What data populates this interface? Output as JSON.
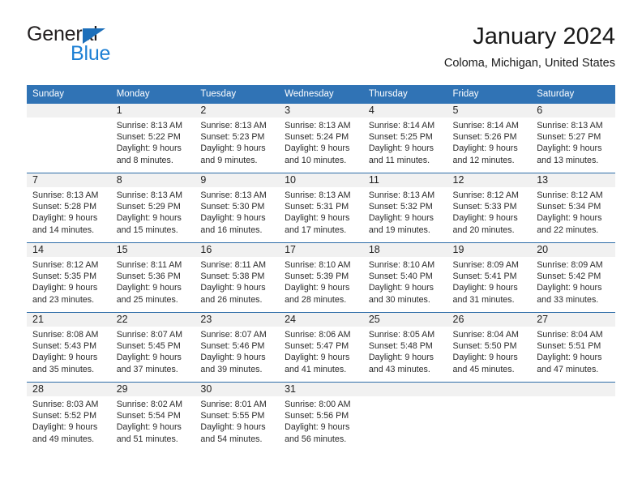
{
  "brand": {
    "name_part1": "General",
    "name_part2": "Blue",
    "triangle_color": "#1c6fba",
    "blue_color": "#1c7fd4"
  },
  "header": {
    "title": "January 2024",
    "subtitle": "Coloma, Michigan, United States"
  },
  "theme": {
    "header_blue": "#3073b5",
    "rule_blue": "#2e6da8",
    "daynum_band": "#f1f1f1"
  },
  "weekday_headers": [
    "Sunday",
    "Monday",
    "Tuesday",
    "Wednesday",
    "Thursday",
    "Friday",
    "Saturday"
  ],
  "weeks": [
    [
      {
        "day": "",
        "lines": []
      },
      {
        "day": "1",
        "lines": [
          "Sunrise: 8:13 AM",
          "Sunset: 5:22 PM",
          "Daylight: 9 hours",
          "and 8 minutes."
        ]
      },
      {
        "day": "2",
        "lines": [
          "Sunrise: 8:13 AM",
          "Sunset: 5:23 PM",
          "Daylight: 9 hours",
          "and 9 minutes."
        ]
      },
      {
        "day": "3",
        "lines": [
          "Sunrise: 8:13 AM",
          "Sunset: 5:24 PM",
          "Daylight: 9 hours",
          "and 10 minutes."
        ]
      },
      {
        "day": "4",
        "lines": [
          "Sunrise: 8:14 AM",
          "Sunset: 5:25 PM",
          "Daylight: 9 hours",
          "and 11 minutes."
        ]
      },
      {
        "day": "5",
        "lines": [
          "Sunrise: 8:14 AM",
          "Sunset: 5:26 PM",
          "Daylight: 9 hours",
          "and 12 minutes."
        ]
      },
      {
        "day": "6",
        "lines": [
          "Sunrise: 8:13 AM",
          "Sunset: 5:27 PM",
          "Daylight: 9 hours",
          "and 13 minutes."
        ]
      }
    ],
    [
      {
        "day": "7",
        "lines": [
          "Sunrise: 8:13 AM",
          "Sunset: 5:28 PM",
          "Daylight: 9 hours",
          "and 14 minutes."
        ]
      },
      {
        "day": "8",
        "lines": [
          "Sunrise: 8:13 AM",
          "Sunset: 5:29 PM",
          "Daylight: 9 hours",
          "and 15 minutes."
        ]
      },
      {
        "day": "9",
        "lines": [
          "Sunrise: 8:13 AM",
          "Sunset: 5:30 PM",
          "Daylight: 9 hours",
          "and 16 minutes."
        ]
      },
      {
        "day": "10",
        "lines": [
          "Sunrise: 8:13 AM",
          "Sunset: 5:31 PM",
          "Daylight: 9 hours",
          "and 17 minutes."
        ]
      },
      {
        "day": "11",
        "lines": [
          "Sunrise: 8:13 AM",
          "Sunset: 5:32 PM",
          "Daylight: 9 hours",
          "and 19 minutes."
        ]
      },
      {
        "day": "12",
        "lines": [
          "Sunrise: 8:12 AM",
          "Sunset: 5:33 PM",
          "Daylight: 9 hours",
          "and 20 minutes."
        ]
      },
      {
        "day": "13",
        "lines": [
          "Sunrise: 8:12 AM",
          "Sunset: 5:34 PM",
          "Daylight: 9 hours",
          "and 22 minutes."
        ]
      }
    ],
    [
      {
        "day": "14",
        "lines": [
          "Sunrise: 8:12 AM",
          "Sunset: 5:35 PM",
          "Daylight: 9 hours",
          "and 23 minutes."
        ]
      },
      {
        "day": "15",
        "lines": [
          "Sunrise: 8:11 AM",
          "Sunset: 5:36 PM",
          "Daylight: 9 hours",
          "and 25 minutes."
        ]
      },
      {
        "day": "16",
        "lines": [
          "Sunrise: 8:11 AM",
          "Sunset: 5:38 PM",
          "Daylight: 9 hours",
          "and 26 minutes."
        ]
      },
      {
        "day": "17",
        "lines": [
          "Sunrise: 8:10 AM",
          "Sunset: 5:39 PM",
          "Daylight: 9 hours",
          "and 28 minutes."
        ]
      },
      {
        "day": "18",
        "lines": [
          "Sunrise: 8:10 AM",
          "Sunset: 5:40 PM",
          "Daylight: 9 hours",
          "and 30 minutes."
        ]
      },
      {
        "day": "19",
        "lines": [
          "Sunrise: 8:09 AM",
          "Sunset: 5:41 PM",
          "Daylight: 9 hours",
          "and 31 minutes."
        ]
      },
      {
        "day": "20",
        "lines": [
          "Sunrise: 8:09 AM",
          "Sunset: 5:42 PM",
          "Daylight: 9 hours",
          "and 33 minutes."
        ]
      }
    ],
    [
      {
        "day": "21",
        "lines": [
          "Sunrise: 8:08 AM",
          "Sunset: 5:43 PM",
          "Daylight: 9 hours",
          "and 35 minutes."
        ]
      },
      {
        "day": "22",
        "lines": [
          "Sunrise: 8:07 AM",
          "Sunset: 5:45 PM",
          "Daylight: 9 hours",
          "and 37 minutes."
        ]
      },
      {
        "day": "23",
        "lines": [
          "Sunrise: 8:07 AM",
          "Sunset: 5:46 PM",
          "Daylight: 9 hours",
          "and 39 minutes."
        ]
      },
      {
        "day": "24",
        "lines": [
          "Sunrise: 8:06 AM",
          "Sunset: 5:47 PM",
          "Daylight: 9 hours",
          "and 41 minutes."
        ]
      },
      {
        "day": "25",
        "lines": [
          "Sunrise: 8:05 AM",
          "Sunset: 5:48 PM",
          "Daylight: 9 hours",
          "and 43 minutes."
        ]
      },
      {
        "day": "26",
        "lines": [
          "Sunrise: 8:04 AM",
          "Sunset: 5:50 PM",
          "Daylight: 9 hours",
          "and 45 minutes."
        ]
      },
      {
        "day": "27",
        "lines": [
          "Sunrise: 8:04 AM",
          "Sunset: 5:51 PM",
          "Daylight: 9 hours",
          "and 47 minutes."
        ]
      }
    ],
    [
      {
        "day": "28",
        "lines": [
          "Sunrise: 8:03 AM",
          "Sunset: 5:52 PM",
          "Daylight: 9 hours",
          "and 49 minutes."
        ]
      },
      {
        "day": "29",
        "lines": [
          "Sunrise: 8:02 AM",
          "Sunset: 5:54 PM",
          "Daylight: 9 hours",
          "and 51 minutes."
        ]
      },
      {
        "day": "30",
        "lines": [
          "Sunrise: 8:01 AM",
          "Sunset: 5:55 PM",
          "Daylight: 9 hours",
          "and 54 minutes."
        ]
      },
      {
        "day": "31",
        "lines": [
          "Sunrise: 8:00 AM",
          "Sunset: 5:56 PM",
          "Daylight: 9 hours",
          "and 56 minutes."
        ]
      },
      {
        "day": "",
        "lines": []
      },
      {
        "day": "",
        "lines": []
      },
      {
        "day": "",
        "lines": []
      }
    ]
  ]
}
